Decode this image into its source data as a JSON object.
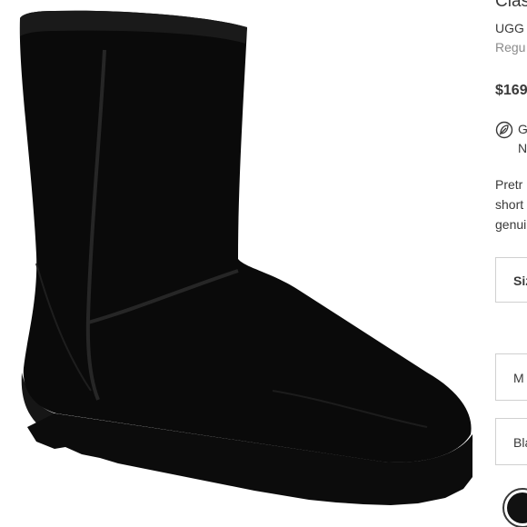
{
  "product": {
    "title": "Clas",
    "brand": "UGG",
    "regular_label": "Regu",
    "price": "$169",
    "badge_icon": "leaf-no-icon",
    "badge_line1": "G",
    "badge_line2": "N",
    "description_lines": [
      "Pretr",
      "short",
      "genui"
    ]
  },
  "options": {
    "size_label": "Siz",
    "width_label": "M",
    "color_label": "Bla"
  },
  "swatch": {
    "selected_color": "#111111"
  }
}
